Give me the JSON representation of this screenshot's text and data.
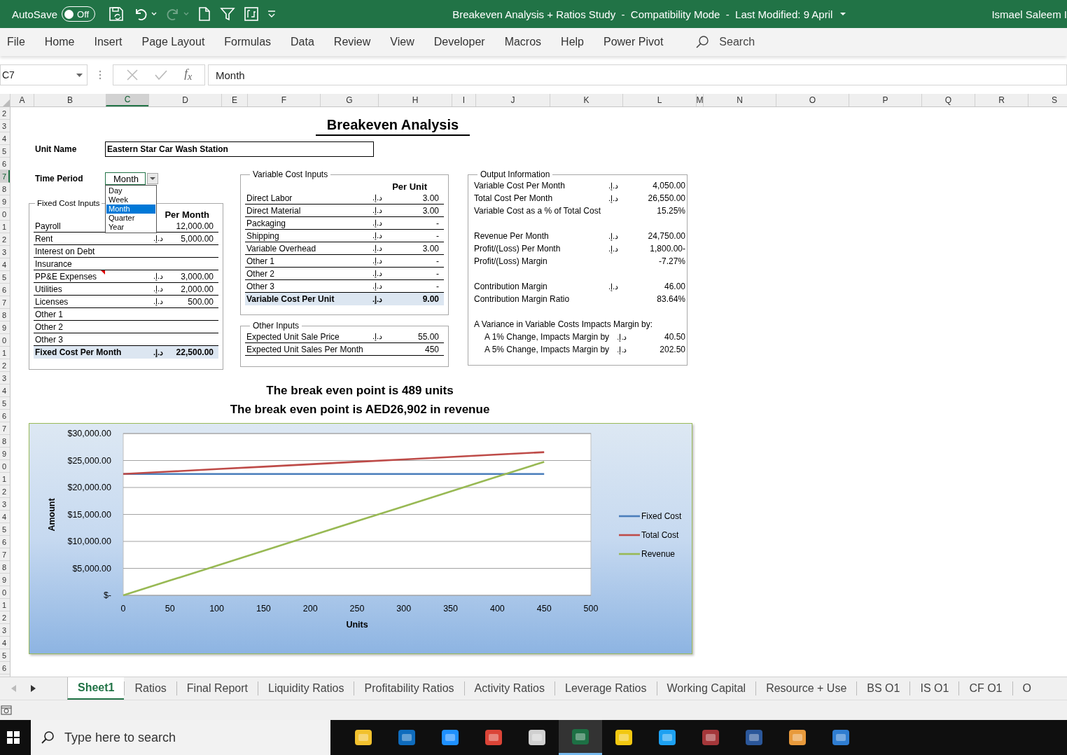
{
  "titlebar": {
    "autosave": {
      "label": "AutoSave",
      "state_text": "Off",
      "on": false
    },
    "redo": {
      "disabled": true
    },
    "title": "Breakeven Analysis + Ratios Study  -  Compatibility Mode  -  Last Modified: 9 April",
    "user": "Ismael Saleem I"
  },
  "ribbon_tabs": [
    "File",
    "Home",
    "Insert",
    "Page Layout",
    "Formulas",
    "Data",
    "Review",
    "View",
    "Developer",
    "Macros",
    "Help",
    "Power Pivot"
  ],
  "search": {
    "placeholder": "Search"
  },
  "formula_bar": {
    "name_box": "C7",
    "fx": "f$_{x}$",
    "value": "Month"
  },
  "columns": [
    {
      "label": "A",
      "selected": false
    },
    {
      "label": "B",
      "selected": false
    },
    {
      "label": "C",
      "selected": true
    },
    {
      "label": "D",
      "selected": false
    },
    {
      "label": "E",
      "selected": false
    },
    {
      "label": "F",
      "selected": false
    },
    {
      "label": "G",
      "selected": false
    },
    {
      "label": "H",
      "selected": false
    },
    {
      "label": "I",
      "selected": false
    },
    {
      "label": "J",
      "selected": false
    },
    {
      "label": "K",
      "selected": false
    },
    {
      "label": "L",
      "selected": false
    },
    {
      "label": "M",
      "selected": false
    },
    {
      "label": "N",
      "selected": false
    },
    {
      "label": "O",
      "selected": false
    },
    {
      "label": "P",
      "selected": false
    },
    {
      "label": "Q",
      "selected": false
    },
    {
      "label": "R",
      "selected": false
    },
    {
      "label": "S",
      "selected": false
    }
  ],
  "rows": [
    {
      "label": "2",
      "selected": false
    },
    {
      "label": "3",
      "selected": false
    },
    {
      "label": "4",
      "selected": false
    },
    {
      "label": "5",
      "selected": false
    },
    {
      "label": "6",
      "selected": false
    },
    {
      "label": "7",
      "selected": true
    },
    {
      "label": "8",
      "selected": false
    },
    {
      "label": "9",
      "selected": false
    },
    {
      "label": "0",
      "selected": false
    },
    {
      "label": "1",
      "selected": false
    },
    {
      "label": "2",
      "selected": false
    },
    {
      "label": "3",
      "selected": false
    },
    {
      "label": "4",
      "selected": false
    },
    {
      "label": "5",
      "selected": false
    },
    {
      "label": "6",
      "selected": false
    },
    {
      "label": "7",
      "selected": false
    },
    {
      "label": "8",
      "selected": false
    },
    {
      "label": "9",
      "selected": false
    },
    {
      "label": "0",
      "selected": false
    },
    {
      "label": "1",
      "selected": false
    },
    {
      "label": "2",
      "selected": false
    },
    {
      "label": "3",
      "selected": false
    },
    {
      "label": "4",
      "selected": false
    },
    {
      "label": "5",
      "selected": false
    },
    {
      "label": "6",
      "selected": false
    },
    {
      "label": "7",
      "selected": false
    },
    {
      "label": "8",
      "selected": false
    },
    {
      "label": "9",
      "selected": false
    },
    {
      "label": "0",
      "selected": false
    },
    {
      "label": "1",
      "selected": false
    },
    {
      "label": "2",
      "selected": false
    },
    {
      "label": "3",
      "selected": false
    },
    {
      "label": "4",
      "selected": false
    },
    {
      "label": "5",
      "selected": false
    },
    {
      "label": "6",
      "selected": false
    },
    {
      "label": "7",
      "selected": false
    },
    {
      "label": "8",
      "selected": false
    },
    {
      "label": "9",
      "selected": false
    },
    {
      "label": "0",
      "selected": false
    },
    {
      "label": "1",
      "selected": false
    },
    {
      "label": "2",
      "selected": false
    },
    {
      "label": "3",
      "selected": false
    },
    {
      "label": "4",
      "selected": false
    },
    {
      "label": "5",
      "selected": false
    },
    {
      "label": "6",
      "selected": false
    }
  ],
  "sheet": {
    "title": "Breakeven Analysis",
    "unit_name": {
      "label": "Unit Name",
      "value": "Eastern Star Car Wash Station"
    },
    "time_period": {
      "label": "Time Period",
      "value": "Month",
      "options": [
        {
          "label": "Day",
          "selected": false
        },
        {
          "label": "Week",
          "selected": false
        },
        {
          "label": "Month",
          "selected": true
        },
        {
          "label": "Quarter",
          "selected": false
        },
        {
          "label": "Year",
          "selected": false
        }
      ]
    },
    "fixed_costs": {
      "title": "Fixed Cost Inputs",
      "header": "Per Month",
      "rows": [
        {
          "label": "Payroll",
          "value": "12,000.00",
          "kind": "item",
          "comment": false
        },
        {
          "label": "Rent",
          "currency": "د.إ.",
          "value": "5,000.00",
          "kind": "item",
          "comment": false
        },
        {
          "label": "Interest on Debt",
          "kind": "item",
          "comment": false
        },
        {
          "label": "Insurance",
          "kind": "item",
          "comment": false
        },
        {
          "label": "PP&E Expenses",
          "currency": "د.إ.",
          "value": "3,000.00",
          "kind": "item",
          "comment": true
        },
        {
          "label": "Utilities",
          "currency": "د.إ.",
          "value": "2,000.00",
          "kind": "item",
          "comment": false
        },
        {
          "label": "Licenses",
          "currency": "د.إ.",
          "value": "500.00",
          "kind": "item",
          "comment": false
        },
        {
          "label": "Other 1",
          "kind": "item",
          "comment": false
        },
        {
          "label": "Other 2",
          "kind": "item",
          "comment": false
        },
        {
          "label": "Other 3",
          "kind": "item",
          "comment": false
        },
        {
          "label": "Fixed Cost Per Month",
          "currency": "د.إ.",
          "value": "22,500.00",
          "kind": "total",
          "comment": false
        }
      ]
    },
    "variable_costs": {
      "title": "Variable Cost Inputs",
      "header": "Per Unit",
      "rows": [
        {
          "label": "Direct Labor",
          "currency": "د.إ.",
          "value": "3.00",
          "kind": "item"
        },
        {
          "label": "Direct Material",
          "currency": "د.إ.",
          "value": "3.00",
          "kind": "item"
        },
        {
          "label": "Packaging",
          "currency": "د.إ.",
          "value": "-",
          "kind": "item"
        },
        {
          "label": "Shipping",
          "currency": "د.إ.",
          "value": "-",
          "kind": "item"
        },
        {
          "label": "Variable Overhead",
          "currency": "د.إ.",
          "value": "3.00",
          "kind": "item"
        },
        {
          "label": "Other 1",
          "currency": "د.إ.",
          "value": "-",
          "kind": "item"
        },
        {
          "label": "Other 2",
          "currency": "د.إ.",
          "value": "-",
          "kind": "item"
        },
        {
          "label": "Other 3",
          "currency": "د.إ.",
          "value": "-",
          "kind": "item"
        },
        {
          "label": "Variable Cost Per Unit",
          "currency": "د.إ.",
          "value": "9.00",
          "kind": "total"
        }
      ]
    },
    "other_inputs": {
      "title": "Other Inputs",
      "rows": [
        {
          "label": "Expected Unit Sale Price",
          "currency": "د.إ.",
          "value": "55.00"
        },
        {
          "label": "Expected Unit Sales Per Month",
          "value": "450"
        }
      ]
    },
    "output": {
      "title": "Output Information",
      "groups": [
        [
          {
            "label": "Variable Cost Per Month",
            "currency": "د.إ.",
            "value": "4,050.00"
          },
          {
            "label": "Total Cost Per Month",
            "currency": "د.إ.",
            "value": "26,550.00"
          },
          {
            "label": "Variable Cost as a % of Total Cost",
            "value": "15.25%"
          }
        ],
        [
          {
            "label": "Revenue Per Month",
            "currency": "د.إ.",
            "value": "24,750.00"
          },
          {
            "label": "Profit/(Loss) Per Month",
            "currency": "د.إ.",
            "value": "1,800.00-"
          },
          {
            "label": "Profit/(Loss) Margin",
            "value": "-7.27%"
          }
        ],
        [
          {
            "label": "Contribution Margin",
            "currency": "د.إ.",
            "value": "46.00"
          },
          {
            "label": "Contribution Margin Ratio",
            "value": "83.64%"
          }
        ]
      ],
      "variance": {
        "title": "A Variance in Variable Costs Impacts Margin by:",
        "rows": [
          {
            "label": "A 1% Change, Impacts Margin by",
            "currency": "د.إ.",
            "value": "40.50"
          },
          {
            "label": "A 5% Change, Impacts Margin by",
            "currency": "د.إ.",
            "value": "202.50"
          }
        ]
      }
    },
    "breakeven_lines": [
      "The break even point is 489 units",
      "The break even point is AED26,902 in revenue"
    ],
    "chart": {
      "chart_data": {
        "type": "line",
        "xlabel": "Units",
        "ylabel": "Amount",
        "x": [
          0,
          50,
          100,
          150,
          200,
          250,
          300,
          350,
          400,
          450
        ],
        "series": [
          {
            "name": "Fixed Cost",
            "color": "#4a7ebb",
            "values": [
              22500,
              22500,
              22500,
              22500,
              22500,
              22500,
              22500,
              22500,
              22500,
              22500
            ]
          },
          {
            "name": "Total Cost",
            "color": "#be4b48",
            "values": [
              22500,
              22950,
              23400,
              23850,
              24300,
              24750,
              25200,
              25650,
              26100,
              26550
            ]
          },
          {
            "name": "Revenue",
            "color": "#98b954",
            "values": [
              0,
              2750,
              5500,
              8250,
              11000,
              13750,
              16500,
              19250,
              22000,
              24750
            ]
          }
        ],
        "grid": true,
        "legend": true,
        "xlim": [
          0,
          500
        ],
        "ylim": [
          0,
          30000
        ],
        "xticks": [
          0,
          50,
          100,
          150,
          200,
          250,
          300,
          350,
          400,
          450,
          500
        ],
        "yticks": [
          {
            "value": 0,
            "label": "$-"
          },
          {
            "value": 5000,
            "label": "$5,000.00"
          },
          {
            "value": 10000,
            "label": "$10,000.00"
          },
          {
            "value": 15000,
            "label": "$15,000.00"
          },
          {
            "value": 20000,
            "label": "$20,000.00"
          },
          {
            "value": 25000,
            "label": "$25,000.00"
          },
          {
            "value": 30000,
            "label": "$30,000.00"
          }
        ]
      }
    }
  },
  "sheet_tabs": [
    {
      "label": "Sheet1",
      "selected": true
    },
    {
      "label": "Ratios",
      "selected": false
    },
    {
      "label": "Final Report",
      "selected": false
    },
    {
      "label": "Liquidity Ratios",
      "selected": false
    },
    {
      "label": "Profitability Ratios",
      "selected": false
    },
    {
      "label": "Activity Ratios",
      "selected": false
    },
    {
      "label": "Leverage Ratios",
      "selected": false
    },
    {
      "label": "Working Capital",
      "selected": false
    },
    {
      "label": "Resource + Use",
      "selected": false
    },
    {
      "label": "BS O1",
      "selected": false
    },
    {
      "label": "IS O1",
      "selected": false
    },
    {
      "label": "CF O1",
      "selected": false
    },
    {
      "label": "O",
      "selected": false
    }
  ],
  "taskbar": {
    "search_placeholder": "Type here to search"
  }
}
